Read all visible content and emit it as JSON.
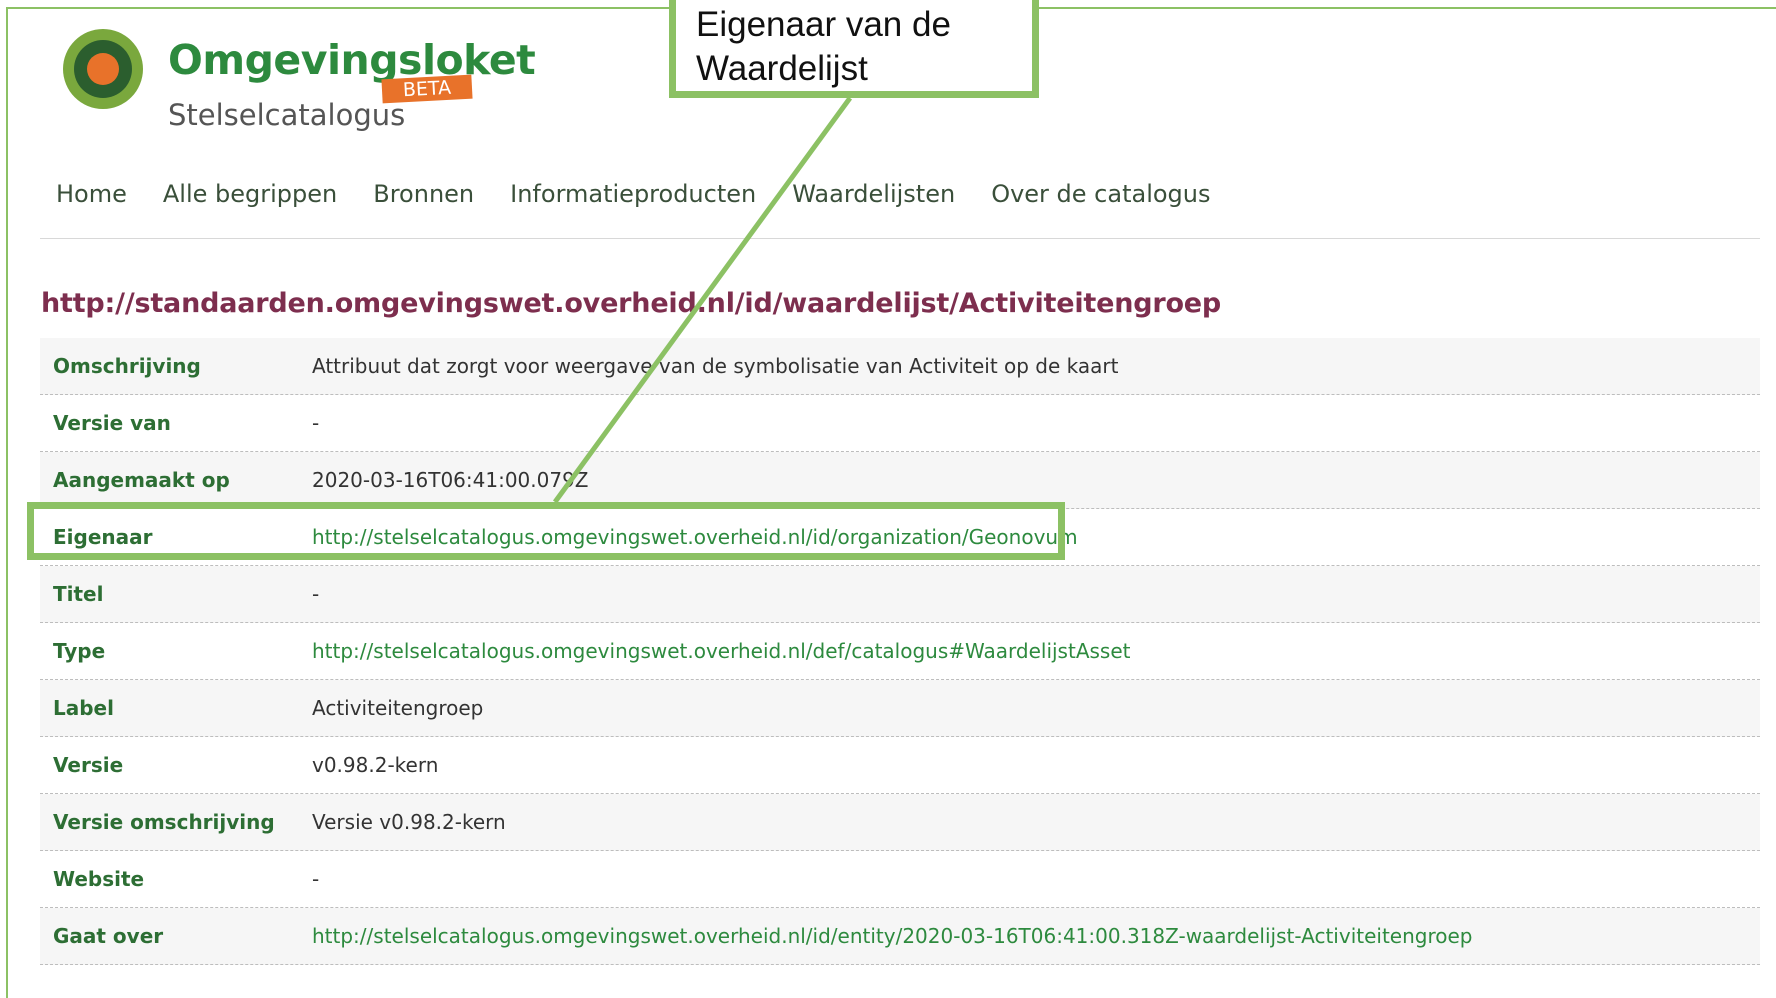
{
  "brand": {
    "name": "Omgevingsloket",
    "badge": "BETA",
    "subtitle": "Stelselcatalogus"
  },
  "nav": {
    "items": [
      "Home",
      "Alle begrippen",
      "Bronnen",
      "Informatieproducten",
      "Waardelijsten",
      "Over de catalogus"
    ]
  },
  "page_title": "http://standaarden.omgevingswet.overheid.nl/id/waardelijst/Activiteitengroep",
  "rows": [
    {
      "key": "Omschrijving",
      "value": "Attribuut dat zorgt voor weergave van de symbolisatie van Activiteit op de kaart"
    },
    {
      "key": "Versie van",
      "value": "-"
    },
    {
      "key": "Aangemaakt op",
      "value": "2020-03-16T06:41:00.079Z"
    },
    {
      "key": "Eigenaar",
      "value": "http://stelselcatalogus.omgevingswet.overheid.nl/id/organization/Geonovum"
    },
    {
      "key": "Titel",
      "value": "-"
    },
    {
      "key": "Type",
      "value": "http://stelselcatalogus.omgevingswet.overheid.nl/def/catalogus#WaardelijstAsset"
    },
    {
      "key": "Label",
      "value": "Activiteitengroep"
    },
    {
      "key": "Versie",
      "value": "v0.98.2-kern"
    },
    {
      "key": "Versie omschrijving",
      "value": "Versie v0.98.2-kern"
    },
    {
      "key": "Website",
      "value": "-"
    },
    {
      "key": "Gaat over",
      "value": "http://stelselcatalogus.omgevingswet.overheid.nl/id/entity/2020-03-16T06:41:00.318Z-waardelijst-Activiteitengroep"
    }
  ],
  "callout": {
    "line1": "Eigenaar van de",
    "line2": "Waardelijst"
  },
  "colors": {
    "accent_green": "#8cc164",
    "brand_green": "#2d8a3e",
    "title_maroon": "#7d2e4e",
    "beta_orange": "#e8722a"
  },
  "icons": {
    "logo": "omgevingsloket-logo-icon"
  }
}
